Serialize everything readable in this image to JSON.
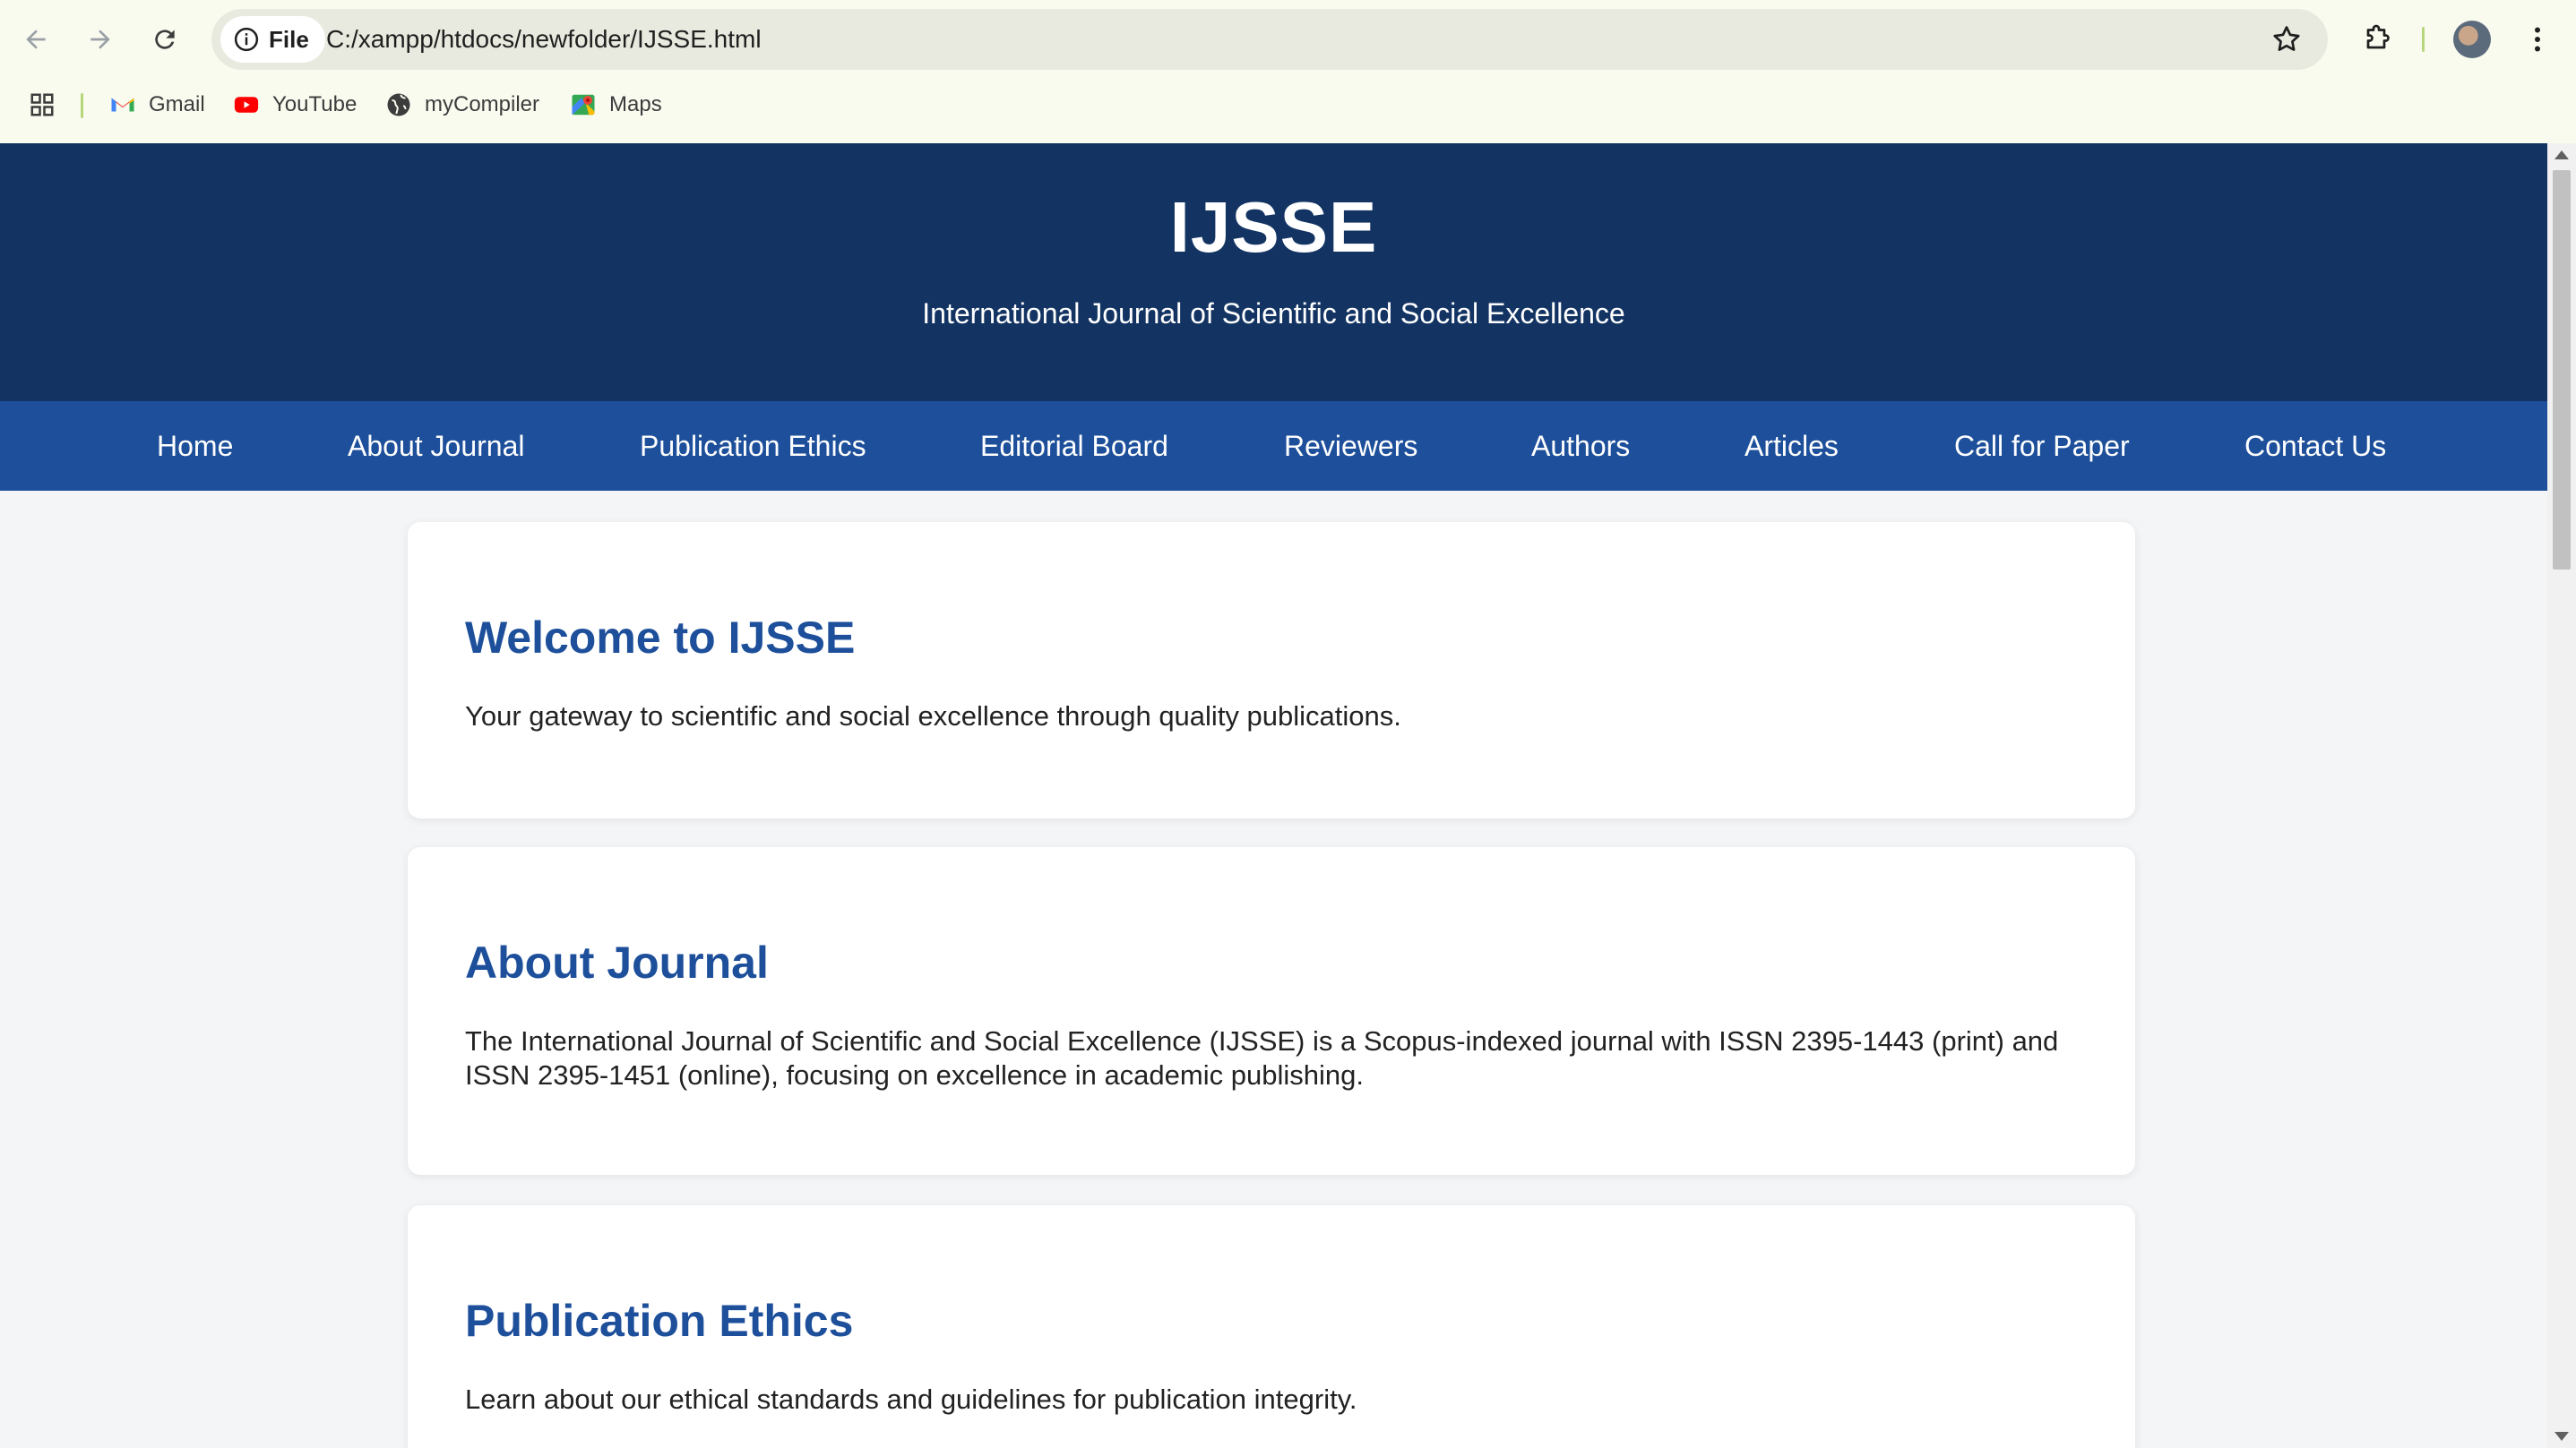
{
  "browser": {
    "site_chip_label": "File",
    "url": "C:/xampp/htdocs/newfolder/IJSSE.html",
    "bookmarks": [
      {
        "label": "Gmail",
        "icon": "gmail-icon"
      },
      {
        "label": "YouTube",
        "icon": "youtube-icon"
      },
      {
        "label": "myCompiler",
        "icon": "globe-icon"
      },
      {
        "label": "Maps",
        "icon": "maps-icon"
      }
    ]
  },
  "header": {
    "title": "IJSSE",
    "subtitle": "International Journal of Scientific and Social Excellence"
  },
  "nav": {
    "items": [
      "Home",
      "About Journal",
      "Publication Ethics",
      "Editorial Board",
      "Reviewers",
      "Authors",
      "Articles",
      "Call for Paper",
      "Contact Us"
    ]
  },
  "sections": [
    {
      "title": "Welcome to IJSSE",
      "text": "Your gateway to scientific and social excellence through quality publications."
    },
    {
      "title": "About Journal",
      "text": "The International Journal of Scientific and Social Excellence (IJSSE) is a Scopus-indexed journal with ISSN 2395-1443 (print) and ISSN 2395-1451 (online), focusing on excellence in academic publishing."
    },
    {
      "title": "Publication Ethics",
      "text": "Learn about our ethical standards and guidelines for publication integrity."
    }
  ],
  "colors": {
    "header_bg": "#133463",
    "nav_bg": "#1d4f9b",
    "heading": "#1d4f9b",
    "page_bg": "#f4f5f7"
  }
}
